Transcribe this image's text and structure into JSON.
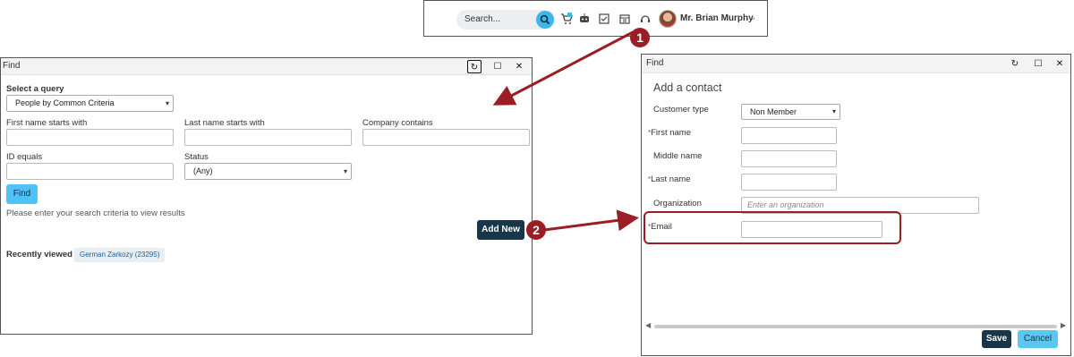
{
  "topbar": {
    "search_placeholder": "Search...",
    "user_name": "Mr. Brian Murphy",
    "cart_badge": "1"
  },
  "find_window": {
    "title": "Find",
    "select_query_label": "Select a query",
    "select_query_value": "People by Common Criteria",
    "first_name_label": "First name starts with",
    "last_name_label": "Last name starts with",
    "company_label": "Company contains",
    "id_label": "ID equals",
    "status_label": "Status",
    "status_value": "(Any)",
    "find_button": "Find",
    "hint": "Please enter your search criteria to view results",
    "add_new_button": "Add New",
    "recently_viewed_label": "Recently viewed",
    "recent_item": "German Zarkozy (23295)"
  },
  "add_window": {
    "title": "Find",
    "heading": "Add a contact",
    "customer_type_label": "Customer type",
    "customer_type_value": "Non Member",
    "first_name_label": "First name",
    "middle_name_label": "Middle name",
    "last_name_label": "Last name",
    "organization_label": "Organization",
    "organization_placeholder": "Enter an organization",
    "email_label": "Email",
    "required_mark": "*",
    "save_button": "Save",
    "cancel_button": "Cancel"
  },
  "callouts": [
    "1",
    "2"
  ],
  "colors": {
    "accent_dark": "#17364a",
    "accent_light": "#4fc3f7",
    "callout": "#9a1e24"
  }
}
